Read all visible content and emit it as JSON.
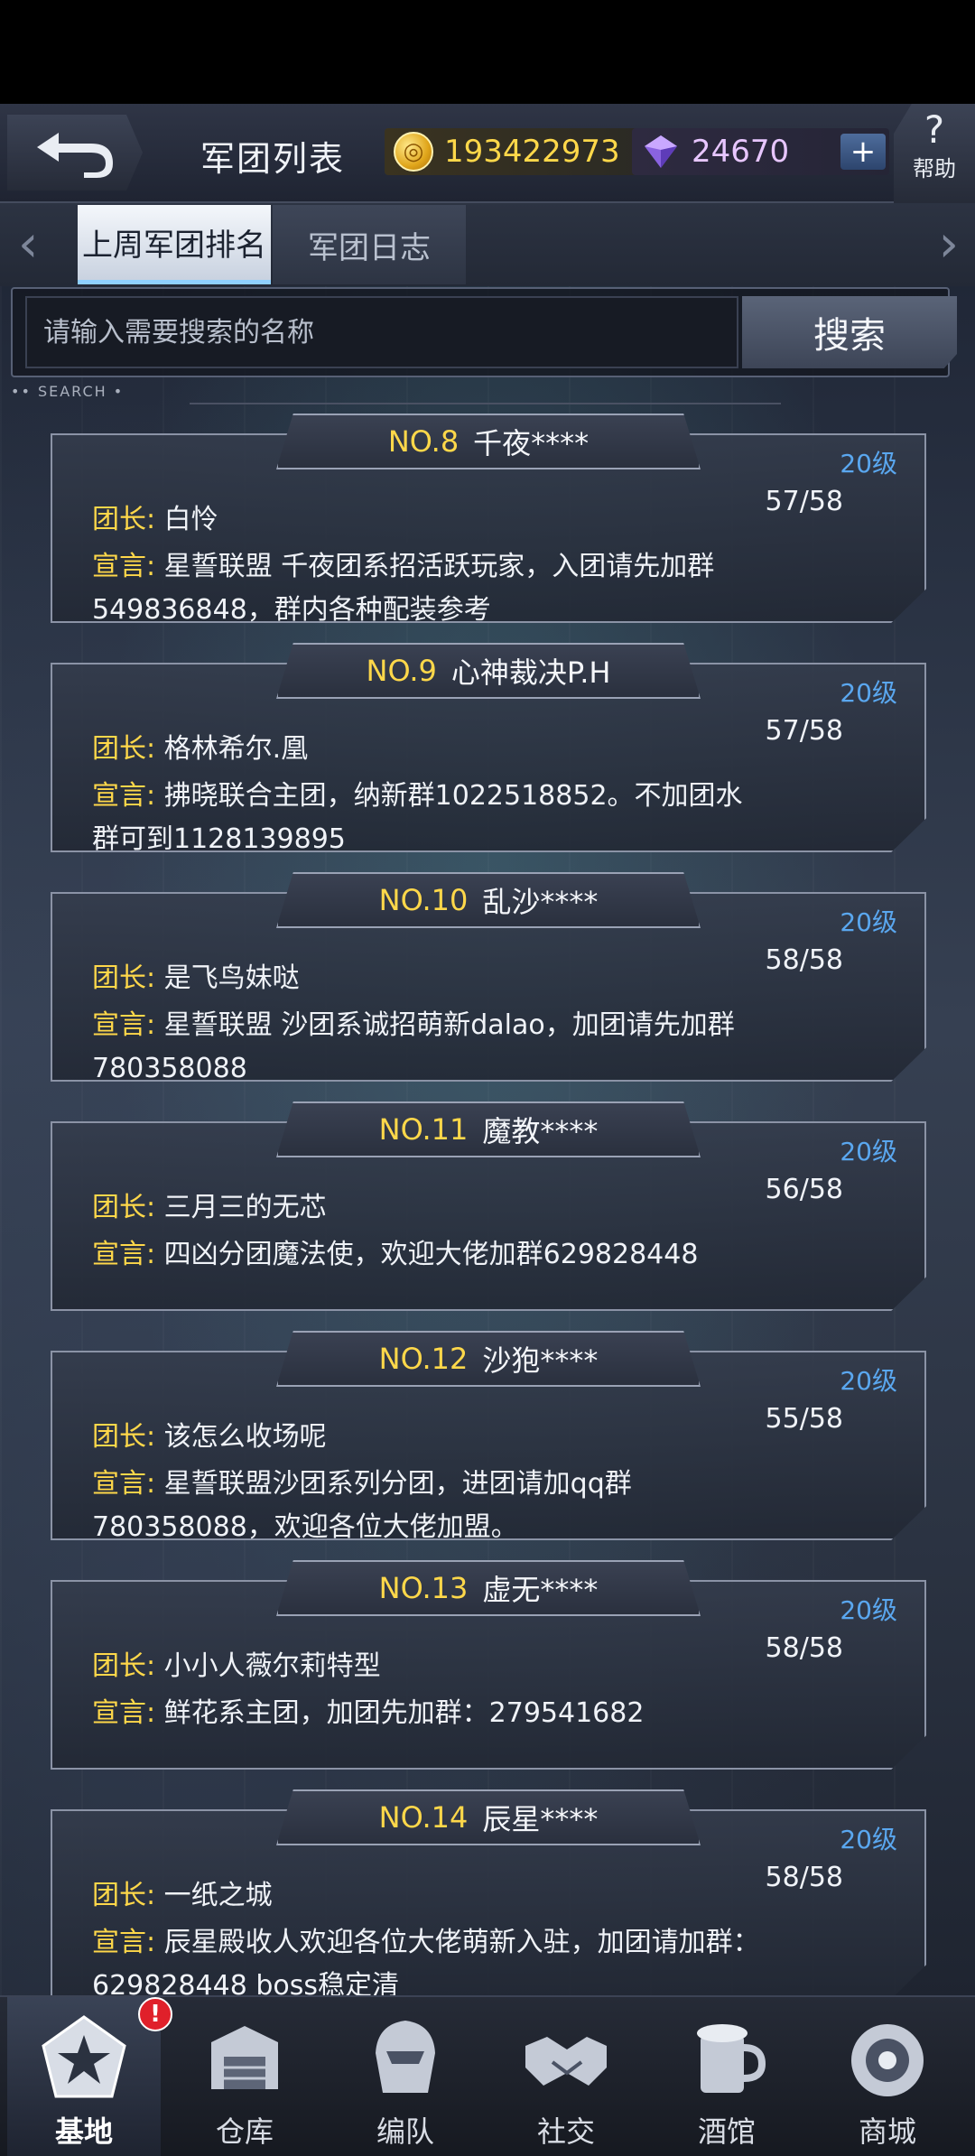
{
  "header": {
    "title": "军团列表",
    "gold_value": "193422973",
    "gem_value": "24670",
    "plus_label": "+",
    "help_label": "帮助",
    "help_symbol": "?"
  },
  "tabs": [
    {
      "label": "上周军团排名",
      "active": true
    },
    {
      "label": "军团日志",
      "active": false
    }
  ],
  "search": {
    "placeholder": "请输入需要搜索的名称",
    "button_label": "搜索",
    "tag": "SEARCH"
  },
  "legions": [
    {
      "rank": "NO.8",
      "name": "千夜****",
      "level": "20级",
      "members": "57/58",
      "leader_key": "团长:",
      "leader": "白怜",
      "slogan_key": "宣言:",
      "slogan": "星誓联盟 千夜团系招活跃玩家，入团请先加群549836848，群内各种配装参考"
    },
    {
      "rank": "NO.9",
      "name": "心神裁决P.H",
      "level": "20级",
      "members": "57/58",
      "leader_key": "团长:",
      "leader": "格林希尔.凰",
      "slogan_key": "宣言:",
      "slogan": "拂晓联合主团，纳新群1022518852。不加团水群可到1128139895"
    },
    {
      "rank": "NO.10",
      "name": "乱沙****",
      "level": "20级",
      "members": "58/58",
      "leader_key": "团长:",
      "leader": "是飞鸟妹哒",
      "slogan_key": "宣言:",
      "slogan": "星誓联盟 沙团系诚招萌新dalao，加团请先加群780358088"
    },
    {
      "rank": "NO.11",
      "name": "魔教****",
      "level": "20级",
      "members": "56/58",
      "leader_key": "团长:",
      "leader": "三月三的无芯",
      "slogan_key": "宣言:",
      "slogan": "四凶分团魔法使，欢迎大佬加群629828448"
    },
    {
      "rank": "NO.12",
      "name": "沙狍****",
      "level": "20级",
      "members": "55/58",
      "leader_key": "团长:",
      "leader": "该怎么收场呢",
      "slogan_key": "宣言:",
      "slogan": "星誓联盟沙团系列分团，进团请加qq群780358088，欢迎各位大佬加盟。"
    },
    {
      "rank": "NO.13",
      "name": "虚无****",
      "level": "20级",
      "members": "58/58",
      "leader_key": "团长:",
      "leader": "小小人薇尔莉特型",
      "slogan_key": "宣言:",
      "slogan": "鲜花系主团，加团先加群：279541682"
    },
    {
      "rank": "NO.14",
      "name": "辰星****",
      "level": "20级",
      "members": "58/58",
      "leader_key": "团长:",
      "leader": "一纸之城",
      "slogan_key": "宣言:",
      "slogan": "辰星殿收人欢迎各位大佬萌新入驻，加团请加群：629828448 boss稳定清"
    }
  ],
  "bottom_nav": [
    {
      "label": "基地",
      "icon": "base-emblem-icon",
      "active": true,
      "badge": "!"
    },
    {
      "label": "仓库",
      "icon": "warehouse-icon",
      "active": false
    },
    {
      "label": "编队",
      "icon": "formation-icon",
      "active": false
    },
    {
      "label": "社交",
      "icon": "handshake-icon",
      "active": false
    },
    {
      "label": "酒馆",
      "icon": "tavern-icon",
      "active": false
    },
    {
      "label": "商城",
      "icon": "shop-icon",
      "active": false
    }
  ],
  "colors": {
    "accent_gold": "#ffd84a",
    "level_blue": "#5aa7ef",
    "badge_red": "#e0202a"
  }
}
